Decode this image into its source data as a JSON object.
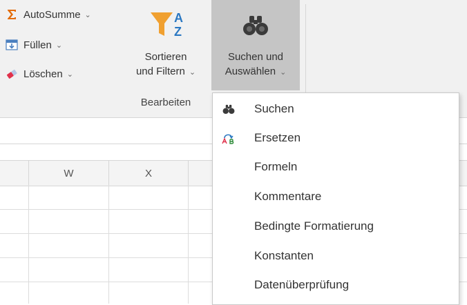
{
  "ribbon": {
    "autosumme_label": "AutoSumme",
    "fuellen_label": "Füllen",
    "loeschen_label": "Löschen",
    "sort_line1": "Sortieren",
    "sort_line2": "und Filtern",
    "find_line1": "Suchen und",
    "find_line2": "Auswählen",
    "group_label": "Bearbeiten",
    "sort_icon_letters": [
      "A",
      "Z"
    ]
  },
  "sheet": {
    "columns": [
      "W",
      "X"
    ]
  },
  "menu": {
    "items": [
      {
        "label": "Suchen",
        "icon": "binoculars-icon"
      },
      {
        "label": "Ersetzen",
        "icon": "replace-icon"
      },
      {
        "label": "Formeln",
        "icon": ""
      },
      {
        "label": "Kommentare",
        "icon": ""
      },
      {
        "label": "Bedingte Formatierung",
        "icon": ""
      },
      {
        "label": "Konstanten",
        "icon": ""
      },
      {
        "label": "Datenüberprüfung",
        "icon": ""
      }
    ]
  },
  "colors": {
    "ribbon_bg": "#f1f1f1",
    "active_button_bg": "#c5c5c5",
    "sigma_orange": "#e36c0a",
    "fill_blue": "#4a7fbf",
    "eraser_red": "#e0314b",
    "sort_funnel_orange": "#f0a030",
    "sort_letters_blue": "#2b78c2"
  }
}
